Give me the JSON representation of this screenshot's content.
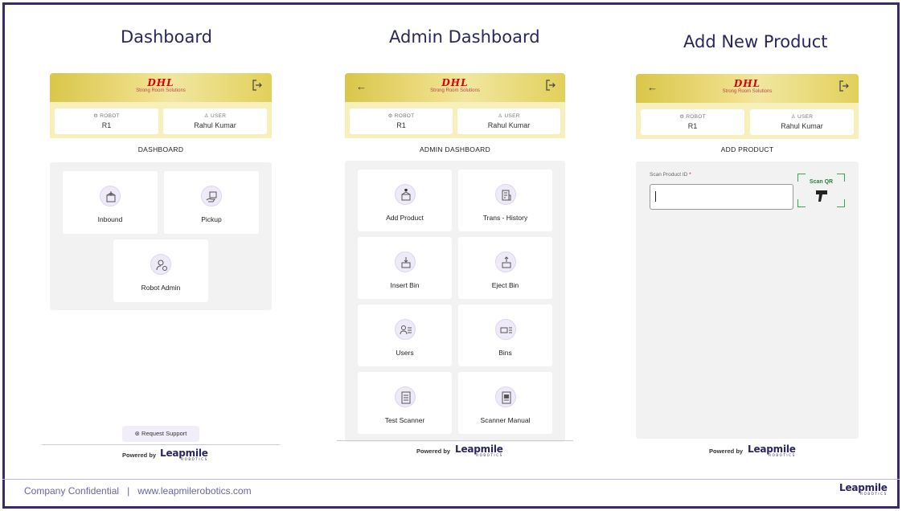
{
  "titles": {
    "col1": "Dashboard",
    "col2": "Admin Dashboard",
    "col3": "Add New Product"
  },
  "brand": {
    "name": "DHL",
    "subtitle": "Strong Room Solutions",
    "color": "#d40511"
  },
  "info": {
    "robot_label": "ROBOT",
    "robot_value": "R1",
    "user_label": "USER",
    "user_value": "Rahul Kumar"
  },
  "dashboard": {
    "section_title": "DASHBOARD",
    "tiles": [
      "Inbound",
      "Pickup",
      "Robot Admin"
    ],
    "support": "Request Support"
  },
  "admin": {
    "section_title": "ADMIN DASHBOARD",
    "tiles": [
      "Add Product",
      "Trans - History",
      "Insert Bin",
      "Eject Bin",
      "Users",
      "Bins",
      "Test Scanner",
      "Scanner Manual"
    ]
  },
  "add_product": {
    "section_title": "ADD PRODUCT",
    "field_label": "Scan Product ID",
    "required_mark": "*",
    "field_value": "",
    "qr_label": "Scan QR"
  },
  "powered": {
    "text": "Powered by",
    "company": "Leapmile",
    "company_sub": "ROBOTICS"
  },
  "footer": {
    "text": "Company Confidential   |   www.leapmilerobotics.com"
  },
  "colors": {
    "accent": "#2a2660",
    "frame": "#3b2a6b",
    "header_yellow": "#e6d66a",
    "qr_green": "#3aa555"
  }
}
